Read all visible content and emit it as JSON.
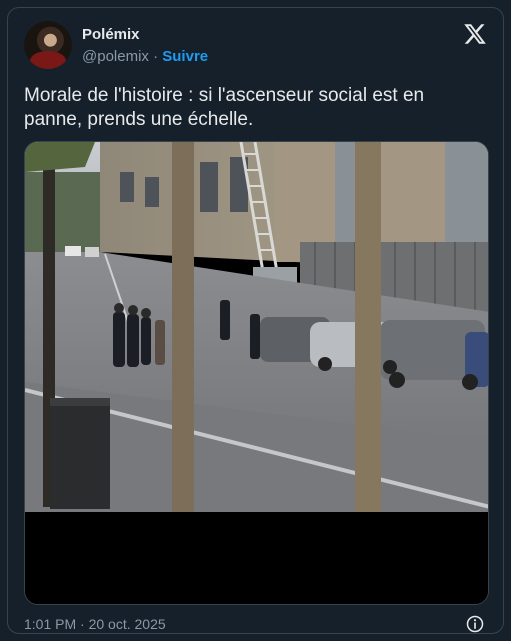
{
  "author": {
    "name": "Polémix",
    "handle": "@polemix",
    "separator": "·",
    "follow_label": "Suivre"
  },
  "tweet": {
    "text": "Morale de l'histoire : si l'ascenseur social est en panne, prends une échelle."
  },
  "footer": {
    "timestamp": "1:01 PM · 20 oct. 2025"
  },
  "icons": {
    "brand": "x-logo-icon",
    "info": "info-icon"
  },
  "colors": {
    "background": "#15202b",
    "text": "#e7e9ea",
    "muted": "#8b98a5",
    "accent": "#1d9bf0",
    "border": "#38444d"
  }
}
